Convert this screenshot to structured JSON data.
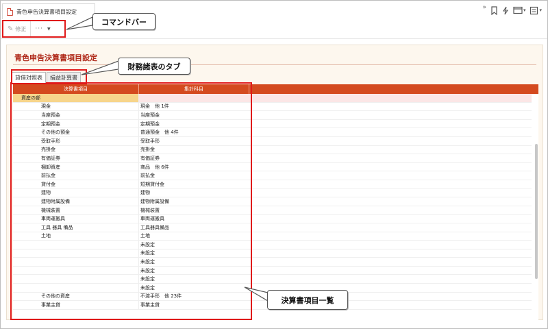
{
  "window": {
    "tab_title": "青色申告決算書項目設定"
  },
  "toolbar": {
    "edit_label": "修正",
    "more_label": "···"
  },
  "top_tools": {
    "expand_glyph": "»"
  },
  "page": {
    "section_title": "青色申告決算書項目設定"
  },
  "tabs": [
    {
      "label": "貸借対照表",
      "active": true
    },
    {
      "label": "損益計算書",
      "active": false
    }
  ],
  "grid": {
    "headers": [
      "決算書項目",
      "集計科目"
    ],
    "rows": [
      {
        "item": "資産の部",
        "account": "",
        "group": true
      },
      {
        "item": "現金",
        "account": "現金　他 1件"
      },
      {
        "item": "当座預金",
        "account": "当座預金"
      },
      {
        "item": "定期預金",
        "account": "定期預金"
      },
      {
        "item": "その他の預金",
        "account": "普通預金　他 4件"
      },
      {
        "item": "受取手形",
        "account": "受取手形"
      },
      {
        "item": "売掛金",
        "account": "売掛金"
      },
      {
        "item": "有価証券",
        "account": "有価証券"
      },
      {
        "item": "棚卸資産",
        "account": "商品　他 6件"
      },
      {
        "item": "前払金",
        "account": "前払金"
      },
      {
        "item": "貸付金",
        "account": "短期貸付金"
      },
      {
        "item": "建物",
        "account": "建物"
      },
      {
        "item": "建物附属設備",
        "account": "建物附属設備"
      },
      {
        "item": "機械装置",
        "account": "機械装置"
      },
      {
        "item": "車両運搬具",
        "account": "車両運搬具"
      },
      {
        "item": "工具 器具 備品",
        "account": "工具器具備品"
      },
      {
        "item": "土地",
        "account": "土地"
      },
      {
        "item": "",
        "account": "未設定"
      },
      {
        "item": "",
        "account": "未設定"
      },
      {
        "item": "",
        "account": "未設定"
      },
      {
        "item": "",
        "account": "未設定"
      },
      {
        "item": "",
        "account": "未設定"
      },
      {
        "item": "",
        "account": "未設定"
      },
      {
        "item": "その他の資産",
        "account": "不渡手形　他 23件"
      },
      {
        "item": "事業主貸",
        "account": "事業主貸"
      }
    ]
  },
  "annotations": {
    "command_bar": "コマンドバー",
    "financial_tabs": "財務諸表のタブ",
    "item_list": "決算書項目一覧"
  },
  "colors": {
    "accent_red": "#e01a1a",
    "header_bg": "#d44a1f",
    "title_red": "#b02a1a",
    "panel_bg": "#fdf7ee",
    "group_yellow": "#f7d58b",
    "group_pink": "#fbe6e6"
  }
}
